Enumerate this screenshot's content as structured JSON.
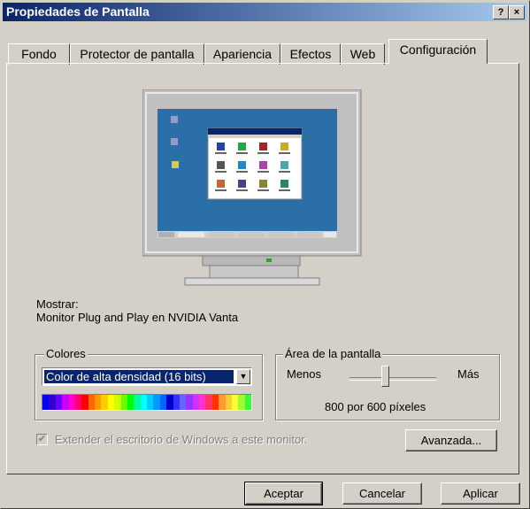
{
  "window": {
    "title": "Propiedades de Pantalla",
    "help_label": "?",
    "close_label": "×"
  },
  "tabs": [
    {
      "label": "Fondo",
      "active": false
    },
    {
      "label": "Protector de pantalla",
      "active": false
    },
    {
      "label": "Apariencia",
      "active": false
    },
    {
      "label": "Efectos",
      "active": false
    },
    {
      "label": "Web",
      "active": false
    },
    {
      "label": "Configuración",
      "active": true
    }
  ],
  "display": {
    "label": "Mostrar:",
    "device": "Monitor Plug and Play en NVIDIA Vanta"
  },
  "colors": {
    "group_label": "Colores",
    "selected": "Color de alta densidad (16 bits)",
    "palette": [
      "#0000ff",
      "#3300cc",
      "#6600ff",
      "#cc00ff",
      "#ff00cc",
      "#ff0066",
      "#ff0000",
      "#ff6600",
      "#ff9900",
      "#ffcc00",
      "#ffff00",
      "#ccff00",
      "#66ff00",
      "#00ff00",
      "#00ff99",
      "#00ffff",
      "#00ccff",
      "#0099ff",
      "#0066ff",
      "#0000cc",
      "#3333ff",
      "#6666ff",
      "#9933ff",
      "#cc33ff",
      "#ff33cc",
      "#ff3366",
      "#ff3300",
      "#ff9933",
      "#ffcc33",
      "#ffff33",
      "#99ff33",
      "#33ff33"
    ]
  },
  "screen_area": {
    "group_label": "Área de la pantalla",
    "less_label": "Menos",
    "more_label": "Más",
    "resolution": "800 por 600 píxeles",
    "slider_level": 0.4
  },
  "extend": {
    "label": "Extender el escritorio de Windows a este monitor.",
    "checked": true,
    "enabled": false
  },
  "buttons": {
    "advanced": "Avanzada...",
    "ok": "Aceptar",
    "cancel": "Cancelar",
    "apply": "Aplicar"
  },
  "preview": {
    "desktop_color": "#2a6fa8",
    "icon_colors": [
      "#2244aa",
      "#22aa44",
      "#aa2222",
      "#ccaa22",
      "#555555",
      "#2288cc",
      "#aa44aa",
      "#44aaaa",
      "#cc6622",
      "#444488",
      "#888822",
      "#228866"
    ]
  }
}
